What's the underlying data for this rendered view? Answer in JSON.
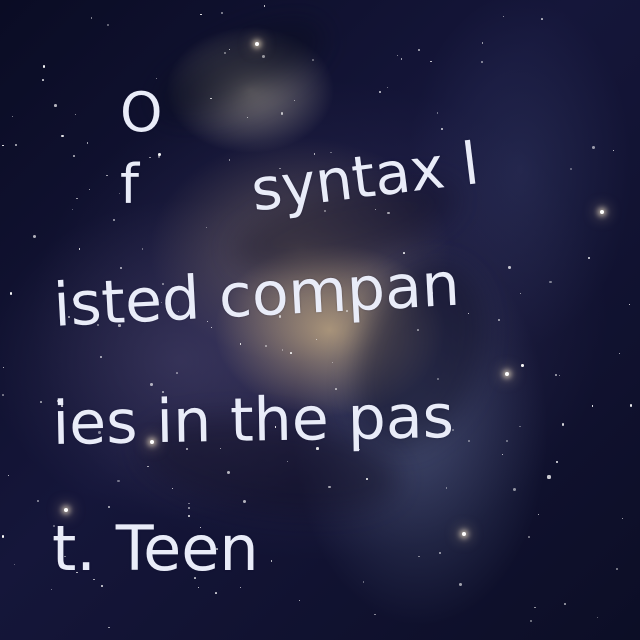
{
  "image": {
    "kind": "starfield-nebula",
    "palette": {
      "sky": "#0b0d22",
      "nebula_warm": "#e1c38c",
      "nebula_cool": "#8296be",
      "text": "#e9ecf8"
    }
  },
  "caption": {
    "lines": [
      "O",
      "f",
      "syntax l",
      "isted compan",
      "ies in the pas",
      "t. Teen"
    ]
  }
}
